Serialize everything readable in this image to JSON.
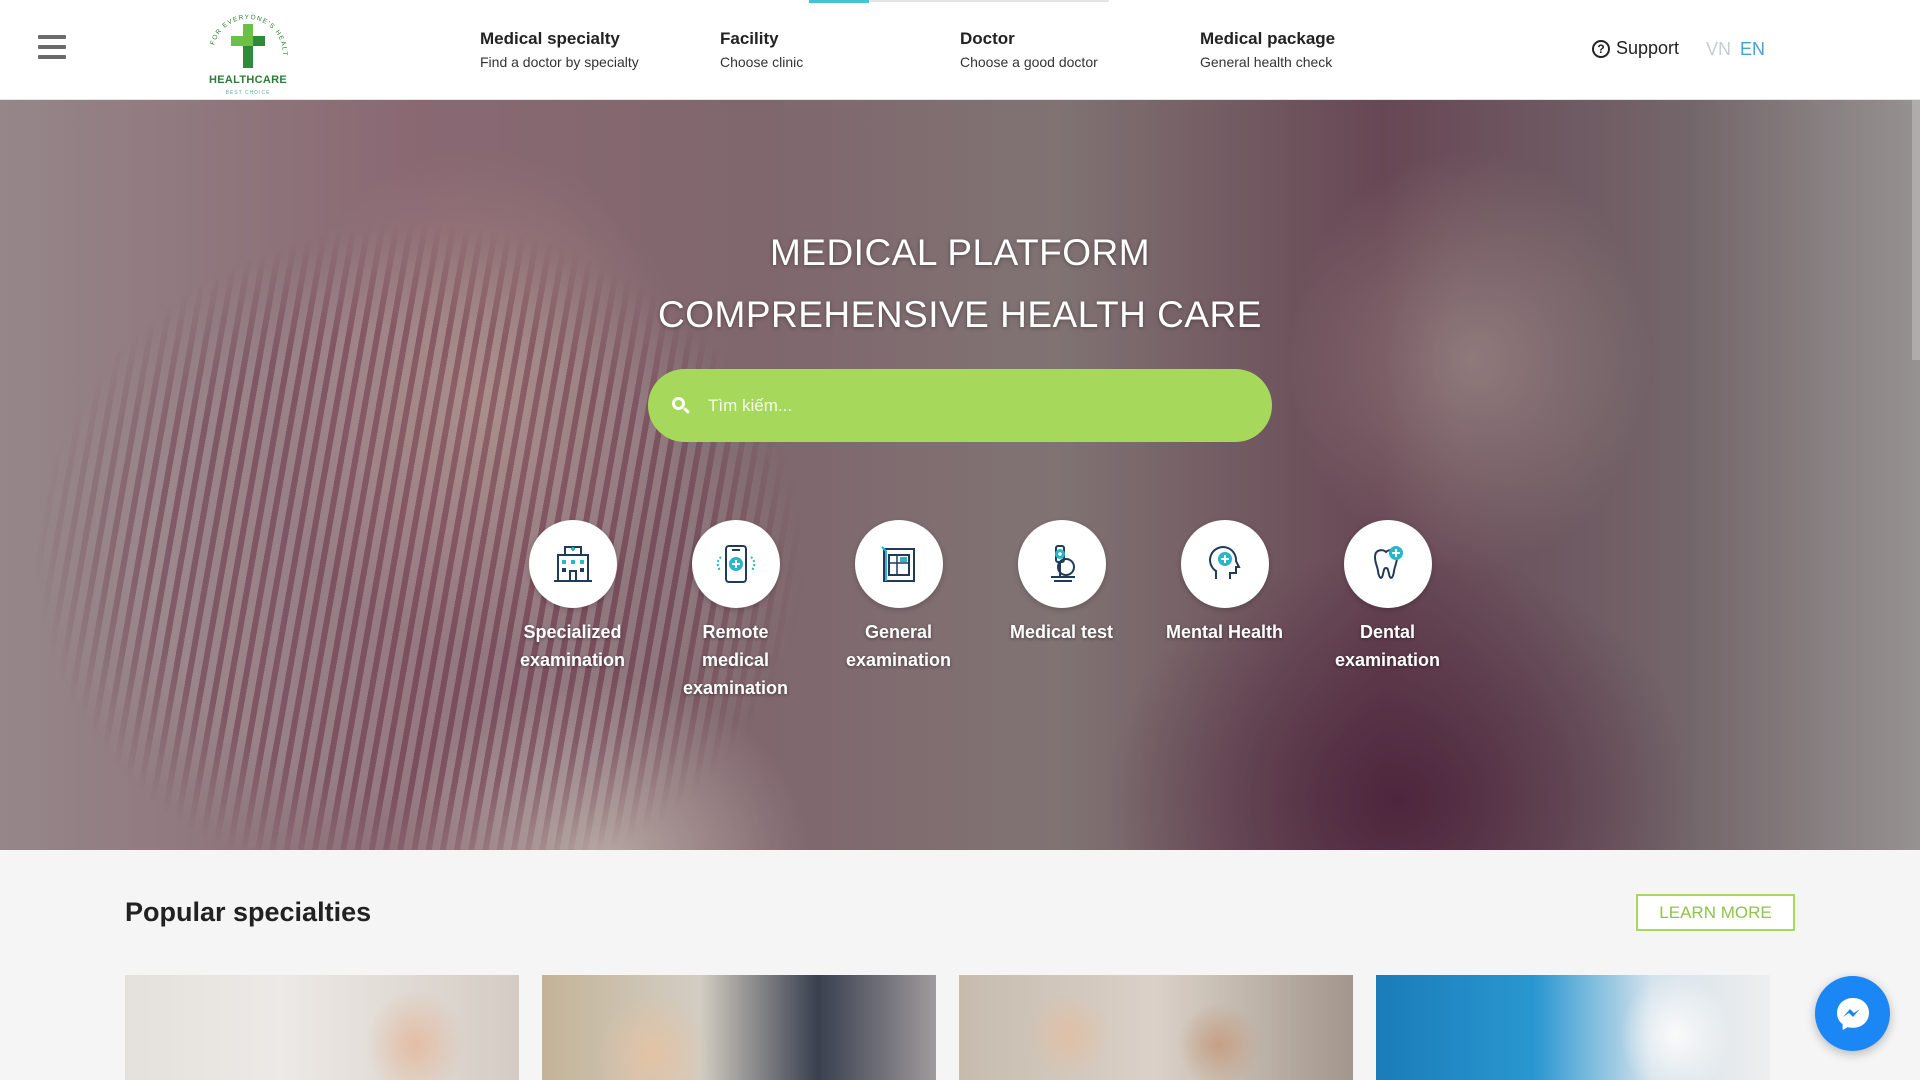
{
  "header": {
    "logo_text": "HEALTHCARE",
    "logo_arc_text": "FOR EVERYONE'S HEALTH",
    "logo_subtext": "BEST CHOICE",
    "nav": [
      {
        "title": "Medical specialty",
        "subtitle": "Find a doctor by specialty"
      },
      {
        "title": "Facility",
        "subtitle": "Choose clinic"
      },
      {
        "title": "Doctor",
        "subtitle": "Choose a good doctor"
      },
      {
        "title": "Medical package",
        "subtitle": "General health check"
      }
    ],
    "support_label": "Support",
    "lang_vn": "VN",
    "lang_en": "EN"
  },
  "hero": {
    "title_line1": "MEDICAL PLATFORM",
    "title_line2": "COMPREHENSIVE HEALTH CARE",
    "search_placeholder": "Tìm kiếm...",
    "services": [
      {
        "label": "Specialized examination",
        "icon": "hospital-icon"
      },
      {
        "label": "Remote medical examination",
        "icon": "phone-medical-icon"
      },
      {
        "label": "General examination",
        "icon": "clipboard-icon"
      },
      {
        "label": "Medical test",
        "icon": "microscope-icon"
      },
      {
        "label": "Mental Health",
        "icon": "brain-head-icon"
      },
      {
        "label": "Dental examination",
        "icon": "tooth-icon"
      }
    ]
  },
  "popular": {
    "title": "Popular specialties",
    "learn_more": "LEARN MORE"
  },
  "colors": {
    "accent_green": "#a6d95b",
    "accent_blue": "#45a3d2",
    "messenger_blue": "#1b87f5"
  }
}
